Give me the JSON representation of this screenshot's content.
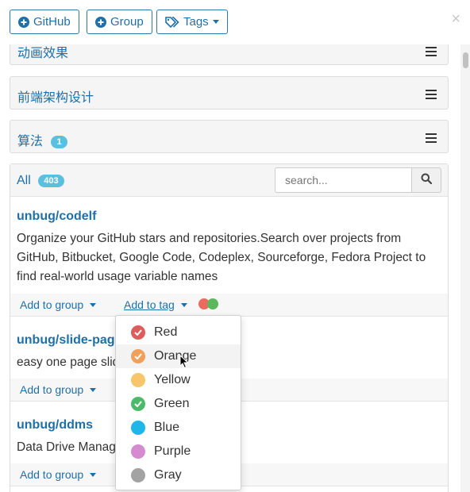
{
  "toolbar": {
    "github_label": "GitHub",
    "group_label": "Group",
    "tags_label": "Tags",
    "close_label": "×"
  },
  "groups": [
    {
      "title": "动画效果"
    },
    {
      "title": "前端架构设计"
    },
    {
      "title": "算法",
      "badge": "1"
    }
  ],
  "all_panel": {
    "title": "All",
    "count": "403",
    "search_placeholder": "search..."
  },
  "repos": [
    {
      "name": "unbug/codelf",
      "description": "Organize your GitHub stars and repositories.Search over projects from GitHub, Bitbucket, Google Code, Codeplex, Sourceforge, Fedora Project to find real-world usage variable names",
      "add_group": "Add to group",
      "add_tag": "Add to tag"
    },
    {
      "name": "unbug/slide-page",
      "description": "easy one page slide",
      "add_group": "Add to group"
    },
    {
      "name": "unbug/ddms",
      "description": "Data Drive Management System",
      "add_group": "Add to group"
    }
  ],
  "tag_dots": [
    "#ec6a5e",
    "#5cb85c"
  ],
  "tag_menu": [
    {
      "label": "Red",
      "color": "#e05c5c",
      "checked": true
    },
    {
      "label": "Orange",
      "color": "#f0a05a",
      "checked": true
    },
    {
      "label": "Yellow",
      "color": "#f7c56a",
      "checked": false
    },
    {
      "label": "Green",
      "color": "#4cba6a",
      "checked": true
    },
    {
      "label": "Blue",
      "color": "#1fb7e8",
      "checked": false
    },
    {
      "label": "Purple",
      "color": "#d68ad0",
      "checked": false
    },
    {
      "label": "Gray",
      "color": "#a3a3a3",
      "checked": false
    }
  ]
}
